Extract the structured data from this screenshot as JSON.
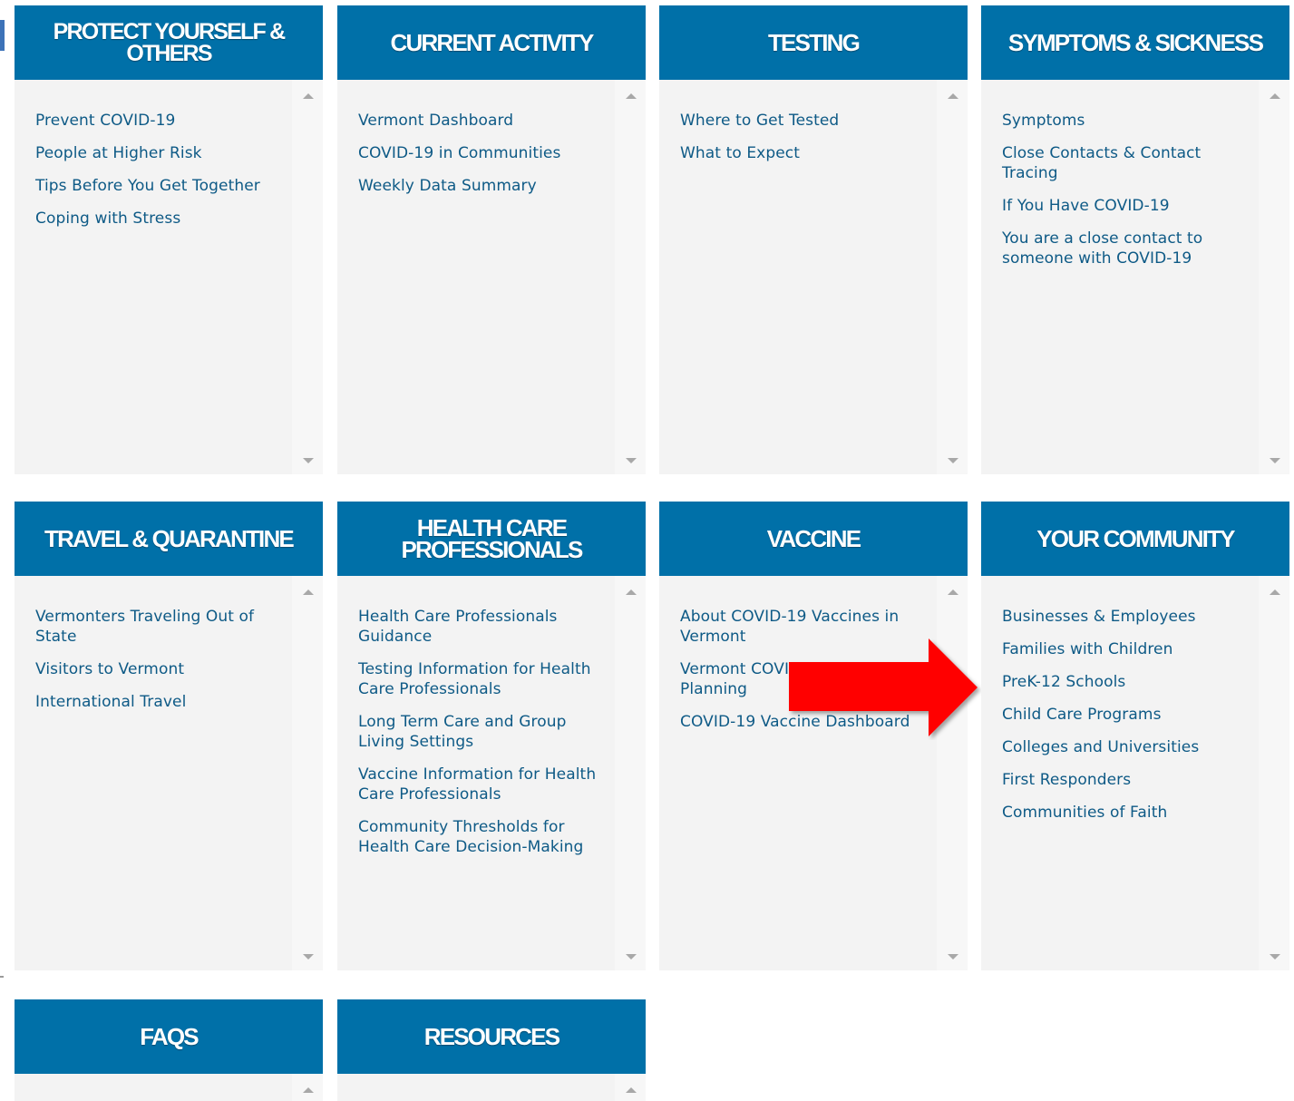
{
  "cards": [
    {
      "title": "PROTECT YOURSELF & OTHERS",
      "links": [
        "Prevent COVID-19",
        "People at Higher Risk",
        "Tips Before You Get Together",
        "Coping with Stress"
      ]
    },
    {
      "title": "CURRENT ACTIVITY",
      "links": [
        "Vermont Dashboard",
        "COVID-19 in Communities",
        "Weekly Data Summary"
      ]
    },
    {
      "title": "TESTING",
      "links": [
        "Where to Get Tested",
        "What to Expect"
      ]
    },
    {
      "title": "SYMPTOMS & SICKNESS",
      "links": [
        "Symptoms",
        "Close Contacts & Contact Tracing",
        "If You Have COVID-19",
        "You are a close contact to someone with COVID-19"
      ]
    },
    {
      "title": "TRAVEL & QUARANTINE",
      "links": [
        "Vermonters Traveling Out of State",
        "Visitors to Vermont",
        "International Travel"
      ]
    },
    {
      "title": "HEALTH CARE PROFESSIONALS",
      "links": [
        "Health Care Professionals Guidance",
        "Testing Information for Health Care Professionals",
        "Long Term Care and Group Living Settings",
        "Vaccine Information for Health Care Professionals",
        "Community Thresholds for Health Care Decision-Making"
      ]
    },
    {
      "title": "VACCINE",
      "links": [
        "About COVID-19 Vaccines in Vermont",
        "Vermont COVID-19 Vaccine Planning",
        "COVID-19 Vaccine Dashboard"
      ]
    },
    {
      "title": "YOUR COMMUNITY",
      "links": [
        "Businesses & Employees",
        "Families with Children",
        "PreK-12 Schools",
        "Child Care Programs",
        "Colleges and Universities",
        "First Responders",
        "Communities of Faith"
      ]
    },
    {
      "title": "FAQS",
      "links": []
    },
    {
      "title": "RESOURCES",
      "links": []
    }
  ],
  "colors": {
    "header": "#0070a8",
    "link": "#0e5a86",
    "panel": "#f3f3f3",
    "annotation_arrow": "#ff0000"
  },
  "icons": {
    "scroll_up": "triangle-up",
    "scroll_down": "triangle-down",
    "annotation": "red-arrow-right"
  }
}
